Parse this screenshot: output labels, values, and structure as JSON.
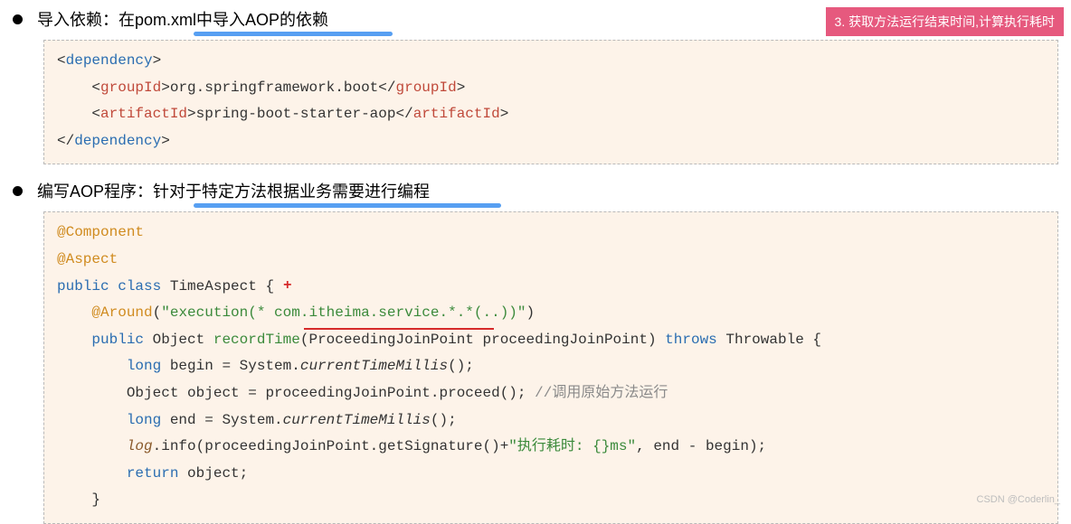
{
  "badge": "3. 获取方法运行结束时间,计算执行耗时",
  "section1": {
    "heading": "导入依赖：在pom.xml中导入AOP的依赖",
    "xml": {
      "dep_open": "dependency",
      "group_open": "groupId",
      "group_text": "org.springframework.boot",
      "artifact_open": "artifactId",
      "artifact_text": "spring-boot-starter-aop"
    }
  },
  "section2": {
    "heading": "编写AOP程序：针对于特定方法根据业务需要进行编程",
    "code": {
      "ann_component": "@Component",
      "ann_aspect": "@Aspect",
      "kw_public": "public",
      "kw_class": "class",
      "cls_name": "TimeAspect",
      "ann_around": "@Around",
      "around_arg": "\"execution(* com.itheima.service.*.*(..))\"",
      "ret_type": "Object",
      "method_name": "recordTime",
      "param_type": "ProceedingJoinPoint",
      "param_name": "proceedingJoinPoint",
      "kw_throws": "throws",
      "throws_type": "Throwable",
      "kw_long": "long",
      "var_begin": "begin",
      "sys_call1": "System.currentTimeMillis()",
      "obj_type": "Object",
      "var_obj": "object",
      "proceed_call": "proceedingJoinPoint.proceed();",
      "comment1": "//调用原始方法运行",
      "var_end": "end",
      "sys_call2": "System.currentTimeMillis()",
      "log_obj": "log",
      "log_call": ".info(proceedingJoinPoint.getSignature()+",
      "log_str": "\"执行耗时: {}ms\"",
      "log_tail": ", end - begin);",
      "kw_return": "return",
      "ret_val": "object;"
    }
  },
  "chart_data": {
    "type": "table",
    "title": "AOP dependency and aspect code",
    "dependency": {
      "groupId": "org.springframework.boot",
      "artifactId": "spring-boot-starter-aop"
    },
    "aspect_class": "TimeAspect",
    "pointcut": "execution(* com.itheima.service.*.*(..))",
    "advice_method": "recordTime",
    "log_message": "执行耗时: {}ms"
  },
  "watermark": "CSDN @Coderlin_"
}
